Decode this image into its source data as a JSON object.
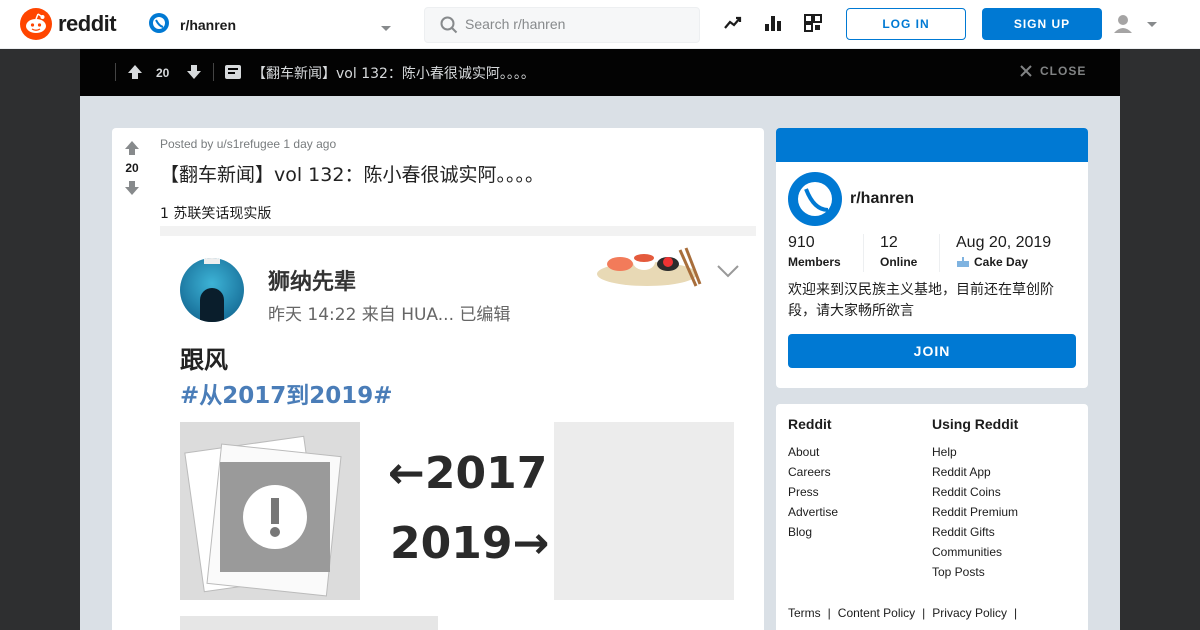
{
  "header": {
    "logo_text": "reddit",
    "community": "r/hanren",
    "search_placeholder": "Search r/hanren",
    "login_label": "LOG IN",
    "signup_label": "SIGN UP"
  },
  "postbar": {
    "score": "20",
    "title": "【翻车新闻】vol 132：陈小春很诚实阿。。。。",
    "close_label": "CLOSE"
  },
  "post": {
    "score": "20",
    "meta": "Posted by u/s1refugee 1 day ago",
    "title": "【翻车新闻】vol 132：陈小春很诚实阿。。。。",
    "body": "1 苏联笑话现实版",
    "image": {
      "name": "狮纳先辈",
      "time": "昨天 14:22  来自 HUA...  已编辑",
      "text": "跟风",
      "tag": "#从2017到2019#",
      "year1": "←2017",
      "year2": "2019→"
    }
  },
  "community_card": {
    "name": "r/hanren",
    "members_value": "910",
    "members_label": "Members",
    "online_value": "12",
    "online_label": "Online",
    "cake_value": "Aug 20, 2019",
    "cake_label": "Cake Day",
    "description": "欢迎来到汉民族主义基地，目前还在草创阶段，请大家畅所欲言",
    "join_label": "JOIN"
  },
  "links_card": {
    "col1_title": "Reddit",
    "col1_links": [
      "About",
      "Careers",
      "Press",
      "Advertise",
      "Blog"
    ],
    "col2_title": "Using Reddit",
    "col2_links": [
      "Help",
      "Reddit App",
      "Reddit Coins",
      "Reddit Premium",
      "Reddit Gifts",
      "Communities",
      "Top Posts"
    ],
    "policy_links": [
      "Terms",
      "Content Policy",
      "Privacy Policy"
    ]
  },
  "colors": {
    "brand_orange": "#ff4500",
    "brand_blue": "#0079d3",
    "overlay_bg": "#dae0e6"
  },
  "icons": [
    "reddit-logo-icon",
    "community-icon",
    "search-icon",
    "trending-icon",
    "stats-icon",
    "coins-icon",
    "user-icon",
    "upvote-icon",
    "downvote-icon",
    "post-icon",
    "close-icon",
    "cake-icon"
  ]
}
